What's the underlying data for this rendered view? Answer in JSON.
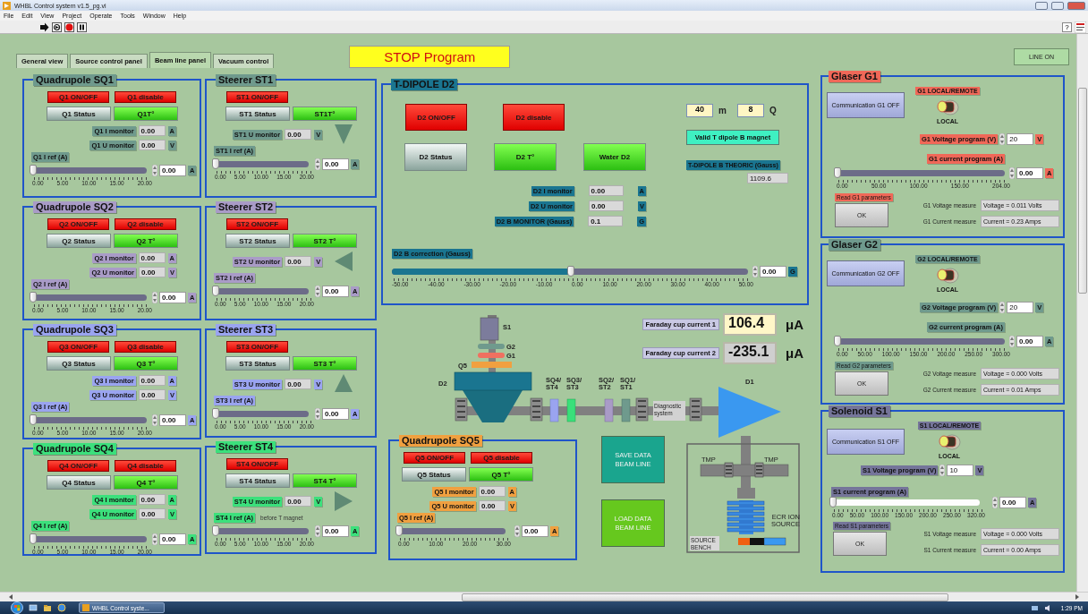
{
  "window": {
    "title": "WHBL Control system v1.5_pg.vi"
  },
  "menu": [
    "File",
    "Edit",
    "View",
    "Project",
    "Operate",
    "Tools",
    "Window",
    "Help"
  ],
  "help": "?",
  "tabs": [
    {
      "label": "General view",
      "selected": false
    },
    {
      "label": "Source control panel",
      "selected": false
    },
    {
      "label": "Beam line panel",
      "selected": true
    },
    {
      "label": "Vacuum control",
      "selected": false
    }
  ],
  "stop_button": "STOP Program",
  "line_button": "LINE ON",
  "quadrupoles": [
    {
      "title": "Quadrupole SQ1",
      "color": "#6f9a8d",
      "switches": [
        "Q1 ON/OFF",
        "Q1 disable"
      ],
      "indicators": [
        {
          "label": "Q1 Status",
          "on": false
        },
        {
          "label": "Q1T°",
          "on": true
        }
      ],
      "monitors": [
        {
          "label": "Q1 I monitor",
          "value": "0.00",
          "unit": "A"
        },
        {
          "label": "Q1 U monitor",
          "value": "0.00",
          "unit": "V"
        }
      ],
      "ref": {
        "label": "Q1 I ref (A)",
        "level": 0,
        "value": "0.00",
        "unit": "A",
        "ticks": [
          "0.00",
          "5.00",
          "10.00",
          "15.00",
          "20.00"
        ]
      }
    },
    {
      "title": "Quadrupole SQ2",
      "color": "#a99bc7",
      "switches": [
        "Q2 ON/OFF",
        "Q2 disable"
      ],
      "indicators": [
        {
          "label": "Q2 Status",
          "on": false
        },
        {
          "label": "Q2 T°",
          "on": true
        }
      ],
      "monitors": [
        {
          "label": "Q2 I monitor",
          "value": "0.00",
          "unit": "A"
        },
        {
          "label": "Q2 U monitor",
          "value": "0.00",
          "unit": "V"
        }
      ],
      "ref": {
        "label": "Q2 I ref (A)",
        "level": 0,
        "value": "0.00",
        "unit": "A",
        "ticks": [
          "0.00",
          "5.00",
          "10.00",
          "15.00",
          "20.00"
        ]
      }
    },
    {
      "title": "Quadrupole SQ3",
      "color": "#9aa4f0",
      "switches": [
        "Q3 ON/OFF",
        "Q3 disable"
      ],
      "indicators": [
        {
          "label": "Q3 Status",
          "on": false
        },
        {
          "label": "Q3 T°",
          "on": true
        }
      ],
      "monitors": [
        {
          "label": "Q3 I monitor",
          "value": "0.00",
          "unit": "A"
        },
        {
          "label": "Q3 U monitor",
          "value": "0.00",
          "unit": "V"
        }
      ],
      "ref": {
        "label": "Q3 I ref (A)",
        "level": 0,
        "value": "0.00",
        "unit": "A",
        "ticks": [
          "0.00",
          "5.00",
          "10.00",
          "15.00",
          "20.00"
        ]
      }
    },
    {
      "title": "Quadrupole SQ4",
      "color": "#3ce07c",
      "switches": [
        "Q4 ON/OFF",
        "Q4 disable"
      ],
      "indicators": [
        {
          "label": "Q4 Status",
          "on": false
        },
        {
          "label": "Q4 T°",
          "on": true
        }
      ],
      "monitors": [
        {
          "label": "Q4 I monitor",
          "value": "0.00",
          "unit": "A"
        },
        {
          "label": "Q4 U monitor",
          "value": "0.00",
          "unit": "V"
        }
      ],
      "ref": {
        "label": "Q4 I ref (A)",
        "level": 0,
        "value": "0.00",
        "unit": "A",
        "ticks": [
          "0.00",
          "5.00",
          "10.00",
          "15.00",
          "20.00"
        ]
      }
    }
  ],
  "steerers": [
    {
      "title": "Steerer ST1",
      "color": "#6f9a8d",
      "switches": [
        "ST1 ON/OFF"
      ],
      "indicators": [
        {
          "label": "ST1 Status",
          "on": false
        },
        {
          "label": "ST1T°",
          "on": true
        }
      ],
      "monitors": [
        {
          "label": "ST1 U monitor",
          "value": "0.00",
          "unit": "V"
        }
      ],
      "kind": "down",
      "ref": {
        "label": "ST1 I ref (A)",
        "level": 0,
        "value": "0.00",
        "unit": "A",
        "ticks": [
          "0.00",
          "5.00",
          "10.00",
          "15.00",
          "20.00"
        ]
      }
    },
    {
      "title": "Steerer ST2",
      "color": "#a99bc7",
      "switches": [
        "ST2 ON/OFF"
      ],
      "indicators": [
        {
          "label": "ST2 Status",
          "on": false
        },
        {
          "label": "ST2 T°",
          "on": true
        }
      ],
      "monitors": [
        {
          "label": "ST2 U monitor",
          "value": "0.00",
          "unit": "V"
        }
      ],
      "kind": "left",
      "ref": {
        "label": "ST2 I ref (A)",
        "level": 0,
        "value": "0.00",
        "unit": "A",
        "ticks": [
          "0.00",
          "5.00",
          "10.00",
          "15.00",
          "20.00"
        ]
      }
    },
    {
      "title": "Steerer ST3",
      "color": "#9aa4f0",
      "switches": [
        "ST3 ON/OFF"
      ],
      "indicators": [
        {
          "label": "ST3 Status",
          "on": false
        },
        {
          "label": "ST3 T°",
          "on": true
        }
      ],
      "monitors": [
        {
          "label": "ST3 U monitor",
          "value": "0.00",
          "unit": "V"
        }
      ],
      "kind": "up",
      "ref": {
        "label": "ST3 I ref (A)",
        "level": 0,
        "value": "0.00",
        "unit": "A",
        "ticks": [
          "0.00",
          "5.00",
          "10.00",
          "15.00",
          "20.00"
        ]
      }
    },
    {
      "title": "Steerer ST4",
      "color": "#3ce07c",
      "switches": [
        "ST4 ON/OFF"
      ],
      "indicators": [
        {
          "label": "ST4 Status",
          "on": false
        },
        {
          "label": "ST4 T°",
          "on": true
        }
      ],
      "monitors": [
        {
          "label": "ST4 U monitor",
          "value": "0.00",
          "unit": "V"
        }
      ],
      "kind": "right",
      "ref": {
        "label": "ST4 I ref (A)",
        "note": "before T magnet",
        "level": 0,
        "value": "0.00",
        "unit": "A",
        "ticks": [
          "0.00",
          "5.00",
          "10.00",
          "15.00",
          "20.00"
        ]
      }
    }
  ],
  "dipole": {
    "title": "T-DIPOLE D2",
    "color": "#1a7590",
    "switches": [
      "D2 ON/OFF",
      "D2 disable"
    ],
    "indicators": [
      {
        "label": "D2 Status",
        "on": false
      },
      {
        "label": "D2 T°",
        "on": true
      },
      {
        "label": "Water D2",
        "on": true
      }
    ],
    "mass": {
      "value": "40",
      "unit": "m"
    },
    "charge": {
      "value": "8",
      "unit": "Q"
    },
    "valid_button": "Valid  T dipole B magnet",
    "theoric": {
      "label": "T-DIPOLE B THEORIC (Gauss)",
      "value": "1109.6"
    },
    "monitors": [
      {
        "label": "D2 I monitor",
        "value": "0.00",
        "unit": "A"
      },
      {
        "label": "D2 U monitor",
        "value": "0.00",
        "unit": "V"
      },
      {
        "label": "D2 B MONITOR (Gauss)",
        "value": "0.1",
        "unit": "G"
      }
    ],
    "correction": {
      "label": "D2 B correction (Gauss)",
      "level": 0.5,
      "value": "0.00",
      "unit": "G",
      "ticks": [
        "-50.00",
        "-40.00",
        "-30.00",
        "-20.00",
        "-10.00",
        "0.00",
        "10.00",
        "20.00",
        "30.00",
        "40.00",
        "50.00"
      ]
    }
  },
  "faraday": [
    {
      "label": "Faraday cup current 1",
      "value": "106.4",
      "unit": "μA"
    },
    {
      "label": "Faraday cup current 2",
      "value": "-235.1",
      "unit": "μA"
    }
  ],
  "beamline": {
    "labels": [
      [
        "S1"
      ],
      [
        "G2"
      ],
      [
        "G1"
      ],
      [
        "Q5"
      ],
      [
        "D2"
      ],
      [
        "SQ4/",
        "ST4"
      ],
      [
        "SQ3/",
        "ST3"
      ],
      [
        "SQ2/",
        "ST2"
      ],
      [
        "SQ1/",
        "ST1"
      ],
      [
        "Diagnostic",
        "system"
      ],
      [
        "D1"
      ],
      [
        "TMP"
      ],
      [
        "TMP"
      ],
      [
        "ECR ION",
        "SOURCE"
      ],
      [
        "SOURCE",
        "BENCH"
      ]
    ]
  },
  "sq5": {
    "title": "Quadrupole SQ5",
    "color": "#f0a040",
    "switches": [
      "Q5 ON/OFF",
      "Q5 disable"
    ],
    "indicators": [
      {
        "label": "Q5 Status",
        "on": false
      },
      {
        "label": "Q5 T°",
        "on": true
      }
    ],
    "monitors": [
      {
        "label": "Q5 I monitor",
        "value": "0.00",
        "unit": "A"
      },
      {
        "label": "Q5 U monitor",
        "value": "0.00",
        "unit": "V"
      }
    ],
    "ref": {
      "label": "Q5 I ref (A)",
      "level": 0,
      "value": "0.00",
      "unit": "A",
      "ticks": [
        "0.00",
        "10.00",
        "20.00",
        "30.00"
      ]
    }
  },
  "data_buttons": [
    {
      "label": "SAVE DATA BEAM LINE",
      "color": "#1aa58e"
    },
    {
      "label": "LOAD DATA BEAM LINE",
      "color": "#66c81e"
    }
  ],
  "coils": [
    {
      "kind": "glaser",
      "title": "Glaser G1",
      "color": "#f06858",
      "comm": "Communication G1 OFF",
      "mode_label": "G1 LOCAL/REMOTE",
      "remote": false,
      "mode": "LOCAL",
      "voltage": {
        "label": "G1 Voltage program (V)",
        "value": "20",
        "unit": "V"
      },
      "current": {
        "label": "G1 current program (A)",
        "level": 0,
        "value": "0.00",
        "unit": "A",
        "ticks": [
          "0.00",
          "50.00",
          "100.00",
          "150.00",
          "204.00"
        ]
      },
      "read_label": "Read G1 parameters",
      "ok": "OK",
      "measures": [
        {
          "label": "G1 Voltage measure",
          "value": "Voltage = 0.011 Volts"
        },
        {
          "label": "G1 Current measure",
          "value": "Current = 0.23 Amps"
        }
      ]
    },
    {
      "kind": "glaser",
      "title": "Glaser G2",
      "color": "#6f9a8d",
      "comm": "Communication G2 OFF",
      "mode_label": "G2 LOCAL/REMOTE",
      "remote": false,
      "mode": "LOCAL",
      "voltage": {
        "label": "G2 Voltage program (V)",
        "value": "20",
        "unit": "V"
      },
      "current": {
        "label": "G2 current program (A)",
        "level": 0,
        "value": "0.00",
        "unit": "A",
        "ticks": [
          "0.00",
          "50.00",
          "100.00",
          "150.00",
          "200.00",
          "250.00",
          "300.00"
        ]
      },
      "read_label": "Read G2 parameters",
      "ok": "OK",
      "measures": [
        {
          "label": "G2 Voltage measure",
          "value": "Voltage = 0.000 Volts"
        },
        {
          "label": "G2 Current measure",
          "value": "Current = 0.01 Amps"
        }
      ]
    },
    {
      "kind": "solenoid",
      "title": "Solenoid S1",
      "color": "#75759a",
      "comm": "Communication S1 OFF",
      "mode_label": "S1 LOCAL/REMOTE",
      "remote": false,
      "mode": "LOCAL",
      "voltage": {
        "label": "S1 Voltage program (V)",
        "value": "10",
        "unit": "V"
      },
      "current": {
        "label": "S1 current program (A)",
        "level": 0,
        "value": "0.00",
        "unit": "A",
        "ticks": [
          "0.00",
          "50.00",
          "100.00",
          "150.00",
          "200.00",
          "250.00",
          "320.00"
        ]
      },
      "read_label": "Read S1 parameters",
      "ok": "OK",
      "measures": [
        {
          "label": "S1 Voltage measure",
          "value": "Voltage = 0.000 Volts"
        },
        {
          "label": "S1 Current measure",
          "value": "Current = 0.00 Amps"
        }
      ]
    }
  ],
  "taskbar": {
    "task": "WHBL Control syste...",
    "clock": "1:29 PM"
  }
}
